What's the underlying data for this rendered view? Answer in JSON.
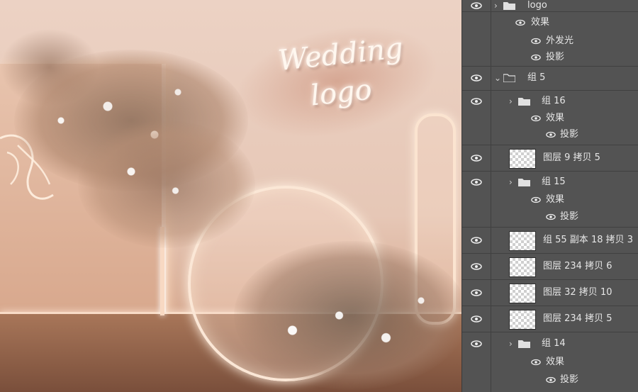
{
  "canvas": {
    "logo_line1": "Wedding",
    "logo_line2": "logo"
  },
  "layers": [
    {
      "type": "group",
      "label": "logo",
      "expanded": false,
      "visible": true
    },
    {
      "type": "effect-header",
      "label": "效果"
    },
    {
      "type": "effect",
      "label": "外发光"
    },
    {
      "type": "effect",
      "label": "投影"
    },
    {
      "type": "group",
      "label": "组 5",
      "expanded": true,
      "visible": true
    },
    {
      "type": "group",
      "label": "组 16",
      "expanded": false,
      "visible": true
    },
    {
      "type": "effect-header",
      "label": "效果"
    },
    {
      "type": "effect",
      "label": "投影"
    },
    {
      "type": "layer",
      "label": "图层 9 拷贝 5",
      "visible": true
    },
    {
      "type": "group",
      "label": "组 15",
      "expanded": false,
      "visible": true
    },
    {
      "type": "effect-header",
      "label": "效果"
    },
    {
      "type": "effect",
      "label": "投影"
    },
    {
      "type": "layer",
      "label": "组 55 副本 18 拷贝 3",
      "visible": true
    },
    {
      "type": "layer",
      "label": "图层 234 拷贝 6",
      "visible": true
    },
    {
      "type": "layer",
      "label": "图层 32 拷贝 10",
      "visible": true
    },
    {
      "type": "layer",
      "label": "图层 234 拷贝 5",
      "visible": true
    },
    {
      "type": "group",
      "label": "组 14",
      "expanded": false,
      "visible": true
    },
    {
      "type": "effect-header",
      "label": "效果"
    },
    {
      "type": "effect",
      "label": "投影"
    }
  ]
}
